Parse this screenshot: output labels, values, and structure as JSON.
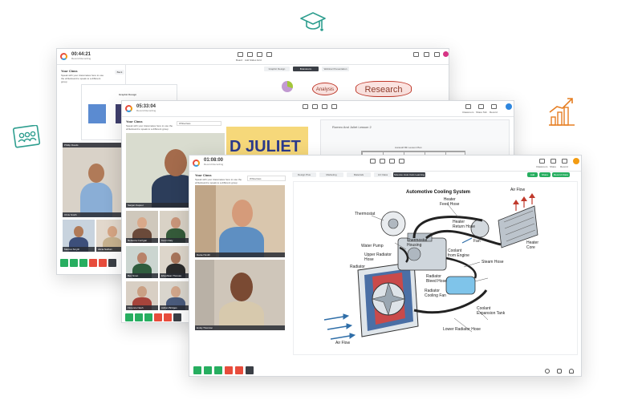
{
  "back_window": {
    "timer": "00:44:21",
    "timer_sub": "Record Recording",
    "panel_title": "Your Class",
    "panel_sub": "Speak with your classmates here to use the whiteboard to speak to a different group",
    "exit_label": "Back",
    "slide_title": "Graphic Design",
    "tabs": [
      "Graphic Design",
      "Brainstorm",
      "Webinar Presentation"
    ],
    "toolbar_labels": [
      "Board",
      "Add Slides",
      "Grid",
      "Participants"
    ],
    "right_labels": [
      "Classroom",
      "Settings",
      "Record Class",
      "Exit"
    ],
    "whiteboard_words": [
      "Analysis",
      "Research"
    ],
    "participants": [
      "Phillip Doods",
      "Chris Smith",
      "Marcus Smyth",
      "Alicia Nathan"
    ]
  },
  "middle_window": {
    "timer": "05:33:04",
    "timer_sub": "Record Recording",
    "panel_title": "Your Class",
    "panel_sub": "Speak with your classmates here to use the whiteboard to speak to a different group",
    "whiteclass_label": "Whiteclass",
    "doc_title": "Romeo And Juliet Lesson 2",
    "doc_heading": "D JULIET",
    "doc_section": "Aurasoft 8th Lesson Plan",
    "right_labels": [
      "Classroom",
      "Share Tab",
      "Record",
      "Exit"
    ],
    "participants": [
      "Sanjan Kapoor",
      "Rebecca Corrigan",
      "Kevin Daly",
      "Ben Smet",
      "Ehushkan Thomas",
      "Florence Nash",
      "Adrian Bridges"
    ]
  },
  "front_window": {
    "timer": "01:08:00",
    "timer_sub": "Record Recording",
    "panel_title": "Your Class",
    "panel_sub": "Speak with your classmates here to use the whiteboard to speak to a different group",
    "whiteclass_label": "Whiteclass",
    "tabs": [
      "Design Plus",
      "Marketing",
      "Materials",
      "Art Class",
      "Science: Auto Cars Learning"
    ],
    "actions": [
      "Add",
      "Share",
      "Record Class"
    ],
    "toolbar_labels": [
      "Classroom",
      "Share",
      "Record",
      "Exit"
    ],
    "participants": [
      "Daniel Smith",
      "Emily Thornton"
    ],
    "controls": [
      "Mic",
      "Cam",
      "Share",
      "Hand",
      "Board",
      "More"
    ],
    "diagram": {
      "title": "Automotive Cooling System",
      "labels": {
        "thermostat": "Thermostat",
        "heater_feed": "Heater\nFeed Hose",
        "air_flow_top": "Air Flow",
        "heater_return": "Heater\nReturn Hose",
        "fan": "Fan",
        "heater_core": "Heater\nCore",
        "thermostat_housing": "Thermostat\nHousing",
        "water_pump": "Water Pump",
        "upper_radiator": "Upper Radiator\nHose",
        "radiator": "Radiator",
        "coolant_engine": "Coolant\nfrom Engine",
        "steam_hose": "Steam Hose",
        "radiator_bleed": "Radiator\nBleed Hose",
        "radiator_fan": "Radiator\nCooling Fan",
        "expansion_tank": "Coolant\nExpansion Tank",
        "lower_radiator": "Lower Radiator Hose",
        "air_flow_bottom": "Air Flow"
      }
    }
  },
  "decor_icons": [
    "graduation-cap-icon",
    "classroom-icon",
    "growth-chart-icon"
  ],
  "colors": {
    "accent": "#27ae60",
    "danger": "#e74c3c",
    "diagram_blue": "#2f6ea8",
    "diagram_red": "#c0392b",
    "coolant": "#5dade2"
  }
}
